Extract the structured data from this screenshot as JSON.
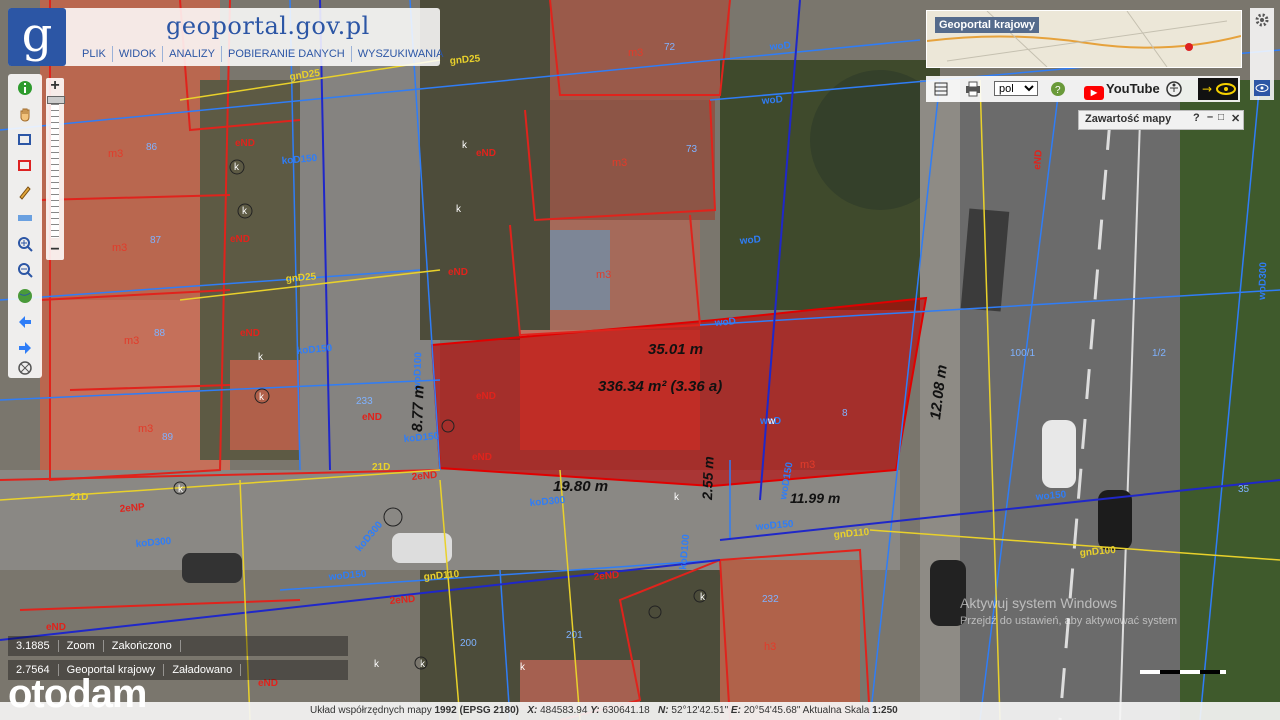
{
  "header": {
    "site_title": "geoportal.gov.pl",
    "logo_letter": "g",
    "menu": [
      "PLIK",
      "WIDOK",
      "ANALIZY",
      "POBIERANIE DANYCH",
      "WYSZUKIWANIA"
    ]
  },
  "right_panel": {
    "minimap_title": "Geoportal krajowy",
    "language": "pol",
    "youtube_label": "YouTube",
    "contents_title": "Zawartość mapy"
  },
  "measurements": {
    "top_edge": "35.01 m",
    "area": "336.34 m² (3.36 a)",
    "left_edge": "8.77 m",
    "right_edge": "12.08 m",
    "bottom_edge": "19.80 m",
    "inner_edge": "2.55 m",
    "bottom_right_edge": "11.99 m"
  },
  "map_labels": {
    "network_labels": [
      "woD",
      "woD",
      "woD",
      "woD",
      "gnD25",
      "gnD25",
      "gnD25",
      "koD150",
      "koD150",
      "koD150",
      "koD300",
      "koD300",
      "koD300",
      "wo150",
      "woD150",
      "woD150",
      "woD150",
      "gnD110",
      "gnD110",
      "gnD100",
      "woD300",
      "woD100",
      "koD100",
      "eND",
      "eND",
      "eND",
      "eND",
      "eND",
      "eND",
      "eND",
      "eND",
      "eND",
      "eND",
      "eND",
      "2eNP",
      "2eND",
      "2eND",
      "2eND",
      "21D",
      "21D",
      "woD"
    ],
    "parcel_numbers": [
      "72",
      "73",
      "86",
      "87",
      "88",
      "89",
      "233",
      "232",
      "200",
      "201",
      "35",
      "1/2",
      "100/1",
      "8"
    ],
    "building_labels": [
      "m3",
      "m3",
      "m3",
      "m3",
      "m3",
      "m3",
      "m3",
      "m3",
      "h3"
    ],
    "chamber_labels": [
      "k",
      "k",
      "k",
      "k",
      "k",
      "k",
      "k",
      "k",
      "k",
      "k",
      "k",
      "k",
      "w"
    ]
  },
  "log": [
    {
      "value": "3.1885",
      "action": "Zoom",
      "state": "Zakończono"
    },
    {
      "value": "2.7564",
      "action": "Geoportal krajowy",
      "state": "Załadowano"
    }
  ],
  "status_bar": {
    "crs_label": "Układ współrzędnych mapy",
    "crs_value": "1992 (EPSG 2180)",
    "x_label": "X:",
    "x_value": "484583.94",
    "y_label": "Y:",
    "y_value": "630641.18",
    "n_label": "N:",
    "n_value": "52°12'42.51\"",
    "e_label": "E:",
    "e_value": "20°54'45.68\"",
    "scale_label": "Aktualna Skala",
    "scale_value": "1:250"
  },
  "overlay": {
    "watermark": "otodam",
    "windows_activation_line1": "Aktywuj system Windows",
    "windows_activation_line2": "Przejdź do ustawień, aby aktywować system"
  },
  "colors": {
    "brand": "#2c56a5",
    "parcel_red": "#e0231c",
    "water_blue": "#2f7df7",
    "sewer_blue": "#1f27c9",
    "gas_yellow": "#e9d12b",
    "highlight": "#b30000"
  }
}
